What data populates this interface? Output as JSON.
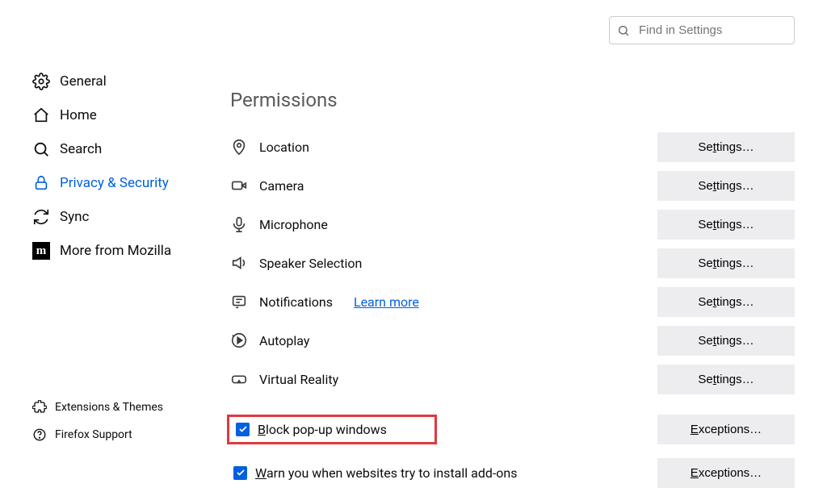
{
  "search": {
    "placeholder": "Find in Settings"
  },
  "sidebar": {
    "items": [
      {
        "label": "General"
      },
      {
        "label": "Home"
      },
      {
        "label": "Search"
      },
      {
        "label": "Privacy & Security"
      },
      {
        "label": "Sync"
      },
      {
        "label": "More from Mozilla"
      }
    ],
    "bottom": [
      {
        "label": "Extensions & Themes"
      },
      {
        "label": "Firefox Support"
      }
    ]
  },
  "main": {
    "section_title": "Permissions",
    "permissions": [
      {
        "label": "Location",
        "button": "Settings…"
      },
      {
        "label": "Camera",
        "button": "Settings…"
      },
      {
        "label": "Microphone",
        "button": "Settings…"
      },
      {
        "label": "Speaker Selection",
        "button": "Settings…"
      },
      {
        "label": "Notifications",
        "button": "Settings…",
        "learn_more": "Learn more"
      },
      {
        "label": "Autoplay",
        "button": "Settings…"
      },
      {
        "label": "Virtual Reality",
        "button": "Settings…"
      }
    ],
    "checkboxes": [
      {
        "char": "B",
        "rest": "lock pop-up windows",
        "button": "Exceptions…",
        "highlight": true
      },
      {
        "char": "W",
        "rest": "arn you when websites try to install add-ons",
        "button": "Exceptions…",
        "highlight": false
      }
    ]
  }
}
